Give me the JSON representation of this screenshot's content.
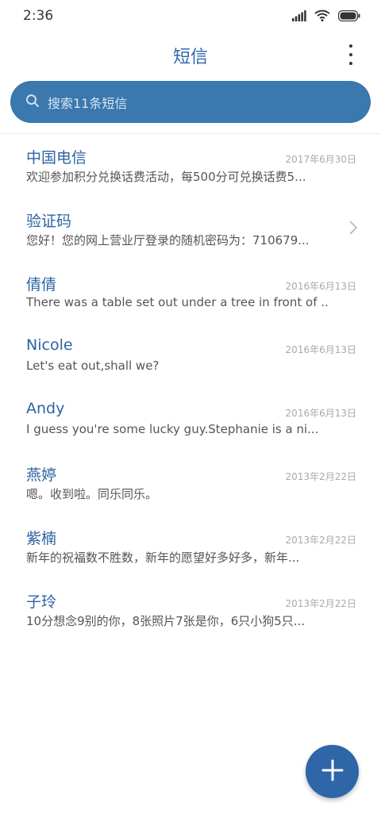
{
  "status_bar": {
    "time": "2:36",
    "icons": [
      "signal-icon",
      "wifi-icon",
      "battery-icon"
    ]
  },
  "header": {
    "title": "短信",
    "menu_icon": "more-vertical-icon"
  },
  "search": {
    "placeholder": "搜索11条短信",
    "icon": "search-icon"
  },
  "conversations": [
    {
      "name": "中国电信",
      "date": "2017年6月30日",
      "preview": "欢迎参加积分兑换话费活动，每500分可兑换话费5..."
    },
    {
      "name": "验证码",
      "date": "",
      "preview": "您好！您的网上营业厅登录的随机密码为：710679...",
      "icon": "chevron-right-icon"
    },
    {
      "name": "倩倩",
      "date": "2016年6月13日",
      "preview": "There was a table set out under a tree in front of ..."
    },
    {
      "name": "Nicole",
      "date": "2016年6月13日",
      "preview": "Let's eat out,shall we?"
    },
    {
      "name": "Andy",
      "date": "2016年6月13日",
      "preview": "I guess you're some lucky guy.Stephanie is a ni..."
    },
    {
      "name": "燕婷",
      "date": "2013年2月22日",
      "preview": "嗯。收到啦。同乐同乐。"
    },
    {
      "name": "紫楠",
      "date": "2013年2月22日",
      "preview": "新年的祝福数不胜数，新年的愿望好多好多，新年..."
    },
    {
      "name": "子玲",
      "date": "2013年2月22日",
      "preview": "10分想念9别的你，8张照片7张是你，6只小狗5只..."
    }
  ],
  "fab": {
    "icon": "plus-icon"
  },
  "colors": {
    "accent": "#2e66a8",
    "search_bg": "#3a78ae",
    "name": "#2d63a2"
  }
}
